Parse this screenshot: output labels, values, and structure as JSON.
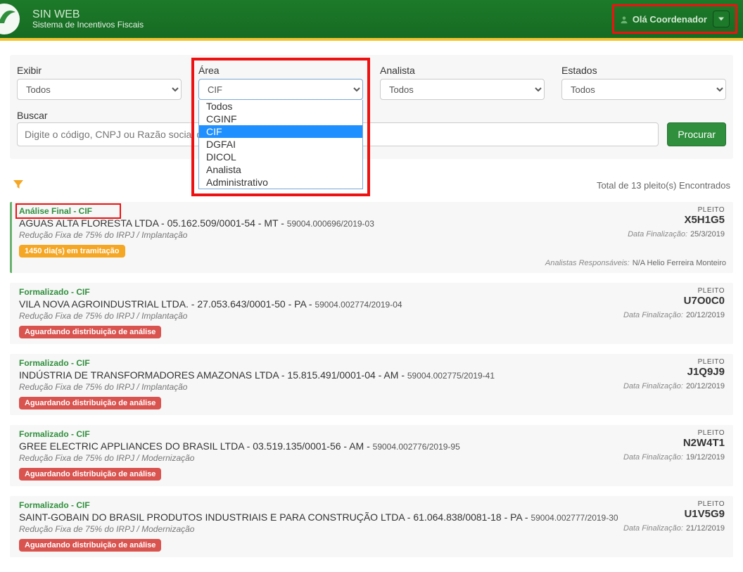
{
  "header": {
    "title": "SIN WEB",
    "subtitle": "Sistema de Incentivos Fiscais",
    "greeting": "Olá Coordenador"
  },
  "filters": {
    "exibir": {
      "label": "Exibir",
      "value": "Todos"
    },
    "area": {
      "label": "Área",
      "value": "CIF",
      "options": [
        "Todos",
        "CGINF",
        "CIF",
        "DGFAI",
        "DICOL",
        "Analista",
        "Administrativo"
      ],
      "selected": "CIF"
    },
    "analista": {
      "label": "Analista",
      "value": "Todos"
    },
    "estados": {
      "label": "Estados",
      "value": "Todos"
    },
    "buscar_label": "Buscar",
    "buscar_placeholder": "Digite o código, CNPJ ou Razão social do pleito.",
    "procurar": "Procurar"
  },
  "results_summary": "Total de 13 pleito(s) Encontrados",
  "pleito_label": "PLEITO",
  "data_fin_label": "Data Finalização:",
  "analistas_label": "Analistas Responsáveis:",
  "cards": [
    {
      "status": "Análise Final - CIF",
      "company": "AGUAS ALTA FLORESTA LTDA",
      "cnpj": "05.162.509/0001-54",
      "uf": "MT",
      "processo": "59004.000696/2019-03",
      "benefit": "Redução Fixa de 75% do IRPJ / Implantação",
      "badge_text": "1450 dia(s) em tramitação",
      "badge_color": "orange",
      "pleito": "X5H1G5",
      "data_fin": "25/3/2019",
      "analistas": "N/A    Helio Ferreira Monteiro"
    },
    {
      "status": "Formalizado - CIF",
      "company": "VILA NOVA AGROINDUSTRIAL LTDA.",
      "cnpj": "27.053.643/0001-50",
      "uf": "PA",
      "processo": "59004.002774/2019-04",
      "benefit": "Redução Fixa de 75% do IRPJ / Implantação",
      "badge_text": "Aguardando distribuição de análise",
      "badge_color": "red",
      "pleito": "U7O0C0",
      "data_fin": "20/12/2019"
    },
    {
      "status": "Formalizado - CIF",
      "company": "INDÚSTRIA DE TRANSFORMADORES AMAZONAS LTDA",
      "cnpj": "15.815.491/0001-04",
      "uf": "AM",
      "processo": "59004.002775/2019-41",
      "benefit": "Redução Fixa de 75% do IRPJ / Implantação",
      "badge_text": "Aguardando distribuição de análise",
      "badge_color": "red",
      "pleito": "J1Q9J9",
      "data_fin": "20/12/2019"
    },
    {
      "status": "Formalizado - CIF",
      "company": "GREE ELECTRIC APPLIANCES DO BRASIL LTDA",
      "cnpj": "03.519.135/0001-56",
      "uf": "AM",
      "processo": "59004.002776/2019-95",
      "benefit": "Redução Fixa de 75% do IRPJ / Modernização",
      "badge_text": "Aguardando distribuição de análise",
      "badge_color": "red",
      "pleito": "N2W4T1",
      "data_fin": "19/12/2019"
    },
    {
      "status": "Formalizado - CIF",
      "company": "SAINT-GOBAIN DO BRASIL PRODUTOS INDUSTRIAIS E PARA CONSTRUÇÃO LTDA",
      "cnpj": "61.064.838/0081-18",
      "uf": "PA",
      "processo": "59004.002777/2019-30",
      "benefit": "Redução Fixa de 75% do IRPJ / Modernização",
      "badge_text": "Aguardando distribuição de análise",
      "badge_color": "red",
      "pleito": "U1V5G9",
      "data_fin": "21/12/2019"
    }
  ]
}
